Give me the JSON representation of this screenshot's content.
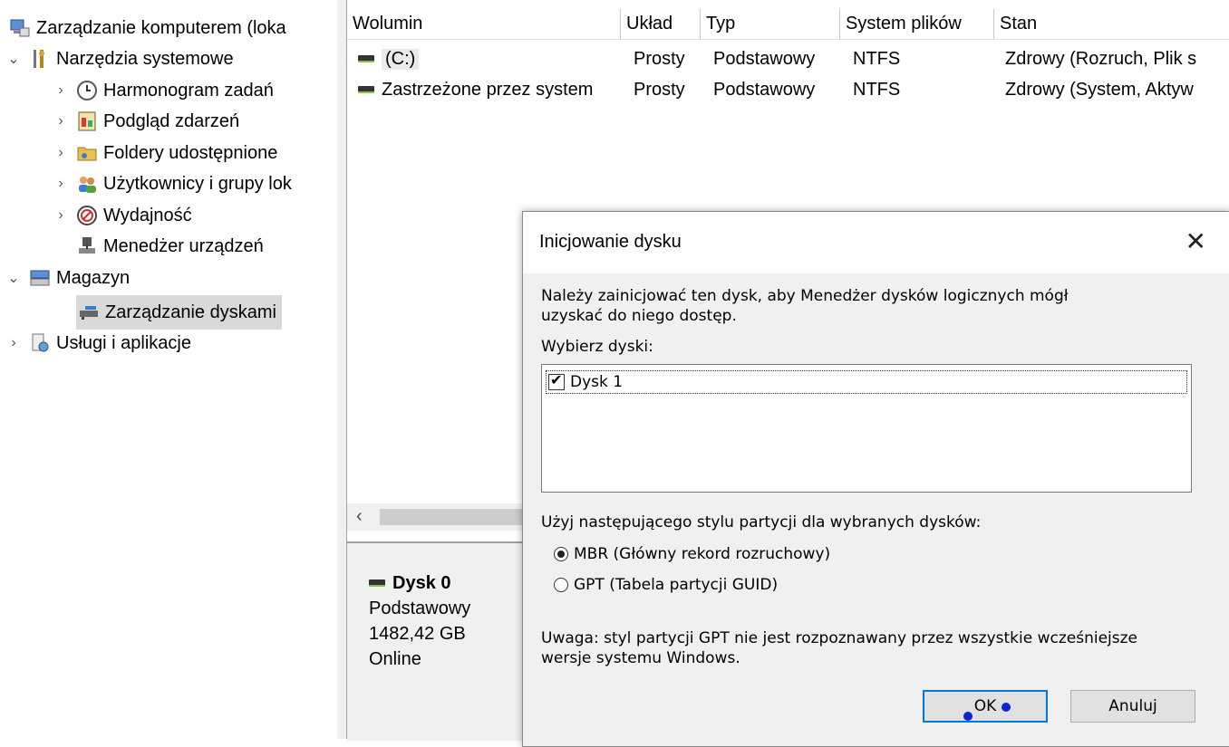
{
  "tree": {
    "root": "Zarządzanie komputerem (loka",
    "system_tools": "Narzędzia systemowe",
    "task_scheduler": "Harmonogram zadań",
    "event_viewer": "Podgląd zdarzeń",
    "shared_folders": "Foldery udostępnione",
    "local_users": "Użytkownicy i grupy lok",
    "performance": "Wydajność",
    "device_manager": "Menedżer urządzeń",
    "storage": "Magazyn",
    "disk_management": "Zarządzanie dyskami",
    "services": "Usługi i aplikacje"
  },
  "list": {
    "columns": [
      "Wolumin",
      "Układ",
      "Typ",
      "System plików",
      "Stan"
    ],
    "rows": [
      {
        "volume": "(C:)",
        "layout": "Prosty",
        "type": "Podstawowy",
        "fs": "NTFS",
        "status": "Zdrowy (Rozruch, Plik s"
      },
      {
        "volume": "Zastrzeżone przez system",
        "layout": "Prosty",
        "type": "Podstawowy",
        "fs": "NTFS",
        "status": "Zdrowy (System, Aktyw"
      }
    ]
  },
  "disk0": {
    "name": "Dysk 0",
    "type": "Podstawowy",
    "size": "1482,42 GB",
    "state": "Online"
  },
  "dialog": {
    "title": "Inicjowanie dysku",
    "intro_line1": "Należy zainicjować ten dysk, aby Menedżer dysków logicznych mógł",
    "intro_line2": "uzyskać do niego dostęp.",
    "select_label": "Wybierz dyski:",
    "disk_item": "Dysk 1",
    "partition_label": "Użyj następującego stylu partycji dla wybranych dysków:",
    "mbr": "MBR (Główny rekord rozruchowy)",
    "gpt": "GPT (Tabela partycji GUID)",
    "note_line1": "Uwaga: styl partycji GPT nie jest rozpoznawany przez wszystkie wcześniejsze",
    "note_line2": "wersje systemu Windows.",
    "ok": "OK",
    "cancel": "Anuluj"
  }
}
